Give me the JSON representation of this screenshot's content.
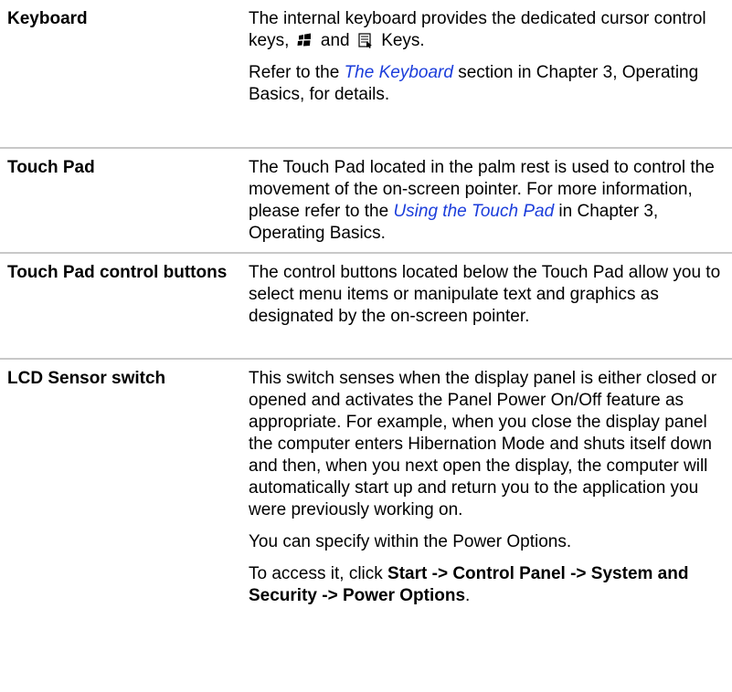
{
  "rows": [
    {
      "term": "Keyboard",
      "paragraphs": {
        "p1_before": "The internal keyboard provides the dedicated cursor control keys,",
        "p1_and": "and",
        "p1_after": "Keys.",
        "p2_before": "Refer to the",
        "p2_link": "The Keyboard",
        "p2_after": "section in Chapter 3, Operating Basics, for details."
      },
      "icons": [
        "windows-key-icon",
        "application-key-icon"
      ]
    },
    {
      "term": "Touch Pad",
      "paragraphs": {
        "p1_before": "The Touch Pad located in the palm rest is used to control the movement of the on-screen pointer. For more information, please refer to the",
        "p1_link": "Using the Touch Pad",
        "p1_after": "in Chapter 3, Operating Basics."
      }
    },
    {
      "term": "Touch Pad control buttons",
      "paragraphs": {
        "p1": "The control buttons located below the Touch Pad allow you to select menu items or manipulate text and graphics as designated by the on-screen pointer."
      }
    },
    {
      "term": "LCD Sensor switch",
      "paragraphs": {
        "p1": "This switch senses when the display panel is either closed or opened and activates the Panel Power On/Off feature as appropriate. For example, when you close the display panel the computer enters Hibernation Mode and shuts itself down and then, when you next open the display, the computer will automatically start up and return you to the application you were previously working on.",
        "p2": "You can specify within the Power Options.",
        "p3_before": "To access it, click",
        "p3_bold": "Start -> Control Panel -> System and Security -> Power Options",
        "p3_after": "."
      }
    }
  ],
  "colors": {
    "link": "#1b3ddb",
    "divider": "#c8c8c8"
  }
}
